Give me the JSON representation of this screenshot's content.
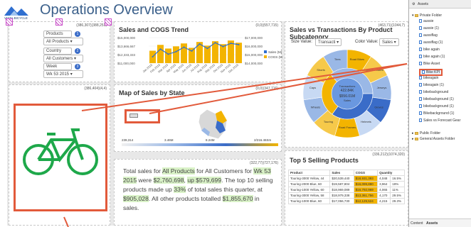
{
  "app": {
    "title": "Operations Overview",
    "logo_text": "VISTA BICYCLE"
  },
  "colors": {
    "accent": "#3a6cc8",
    "bar": "#f3b400",
    "line": "#2f6fd0",
    "callout": "#e25a3b",
    "bike": "#1ea84a",
    "highlight": "#d9f2c7"
  },
  "filters": {
    "products": {
      "label": "Products",
      "value": "All Products",
      "num": "1"
    },
    "country": {
      "label": "Country",
      "value": "All Customers",
      "num": "2"
    },
    "week": {
      "label": "Week",
      "value": "Wk 53 2015",
      "num": "3"
    }
  },
  "sizes": {
    "filters": "(386,307)(388,251)",
    "trend": "(0,0)(557,715)",
    "subcat": "(463,71)(1044,7)",
    "image": "(386,404)(4,4)",
    "map": "(0,0)(347,716)",
    "text": "(322,77)(727,176)",
    "top": "(336,212)(1074,320)"
  },
  "trend": {
    "title": "Sales and COGS Trend",
    "y_left": [
      "$15,000,000",
      "$13,666,667",
      "$12,333,333",
      "$11,000,000"
    ],
    "y_right": [
      "$17,000,000",
      "$16,000,000",
      "$15,000,000",
      "$14,000,000"
    ],
    "x": [
      "Jan 2015",
      "Feb 2015",
      "Mar 2015",
      "Apr 2015",
      "May 2015",
      "Jun 2015",
      "Jul 2015",
      "Aug 2015",
      "Sep 2015",
      "Oct 2015",
      "Nov 2015",
      "Dec 2015"
    ],
    "legend": [
      "Sales (M)",
      "COGS (M)"
    ]
  },
  "chart_data": {
    "type": "bar",
    "categories": [
      "Jan 2015",
      "Feb 2015",
      "Mar 2015",
      "Apr 2015",
      "May 2015",
      "Jun 2015",
      "Jul 2015",
      "Aug 2015",
      "Sep 2015",
      "Oct 2015",
      "Nov 2015",
      "Dec 2015"
    ],
    "series": [
      {
        "name": "COGS",
        "values": [
          15.2,
          16.0,
          15.5,
          15.8,
          16.2,
          15.6,
          16.4,
          15.9,
          16.5,
          16.1,
          16.6,
          16.3
        ]
      },
      {
        "name": "Sales",
        "values": [
          12.0,
          13.2,
          12.4,
          12.8,
          13.5,
          12.9,
          14.0,
          13.3,
          14.2,
          13.6,
          14.1,
          13.9
        ]
      }
    ]
  },
  "subcat": {
    "title": "Sales vs Transactions By Product Subcategory",
    "size_label": "Size Value:",
    "size_value": "Transacti ▾",
    "color_label": "Color Value:",
    "color_value": "Sales ▾",
    "center": {
      "l1": "Transactions",
      "l2": "422.84K",
      "l3": "$556.01M",
      "l4": "Sales"
    },
    "segments": [
      "Road Bikes",
      "Mountain Bikes",
      "Jerseys",
      "Gloves",
      "Helmets",
      "Road Frames",
      "Touring",
      "Wheels",
      "Caps",
      "Shorts",
      "Tires"
    ]
  },
  "map": {
    "title": "Map of Sales by State",
    "scale": [
      "239,314",
      "3.46M",
      "8.24M",
      "2/216.46Sm"
    ]
  },
  "text": {
    "p1": "Total sales for ",
    "hl1": "All Products",
    "p2": " for ",
    "hl2": "All Customers",
    "p3": " for ",
    "hl3": "Wk 53 2015",
    "p4": " were ",
    "hl4": "$2,760,698",
    "p5": ", ",
    "hl5": "up $579,699",
    "p6": ". The top 10 selling products made up ",
    "hl6": "33%",
    "p7": " of total sales this quarter, at ",
    "hl7": "$905,028",
    "p8": ". All other products totalled ",
    "hl8": "$1,855,670",
    "p9": " in sales."
  },
  "top": {
    "title": "Top 5 Selling Products",
    "headers": [
      "Product",
      "Sales",
      "COGS",
      "Quantity"
    ],
    "rows": [
      [
        "Touring-3000 Yellow, 44",
        "$20,539,440",
        "$18,931,393",
        "4,048",
        "16.5%"
      ],
      [
        "Touring-2000 Blue, 60",
        "$19,587,804",
        "$16,099,880",
        "3,964",
        "19%"
      ],
      [
        "Touring-1000 Yellow, 60",
        "$18,969,089",
        "$16,792,969",
        "4,065",
        "11%"
      ],
      [
        "Touring-3000 Yellow, 58",
        "$18,979,338",
        "$13,361,756",
        "4,170",
        "29.5%"
      ],
      [
        "Touring-1000 Blue, 60",
        "$17,056,730",
        "$12,129,524",
        "4,215",
        "29.3%"
      ]
    ]
  },
  "assets": {
    "header": "Assets",
    "private": "Private Folder",
    "public": "Public Folder",
    "general": "General Assets Folder",
    "items": [
      "aussie",
      "aussie (1)",
      "aussiflag",
      "aussiflag (1)",
      "bike again",
      "bike again (1)",
      "Bike Asset",
      "Bike KPI",
      "bikeagain",
      "bikeagain (1)",
      "bikebackground",
      "bikebackground (1)",
      "bikebackground (1)",
      "Bikebackground (1)",
      "Sales vs Forecast Gear"
    ],
    "tabs": [
      "Content",
      "Assets"
    ]
  }
}
